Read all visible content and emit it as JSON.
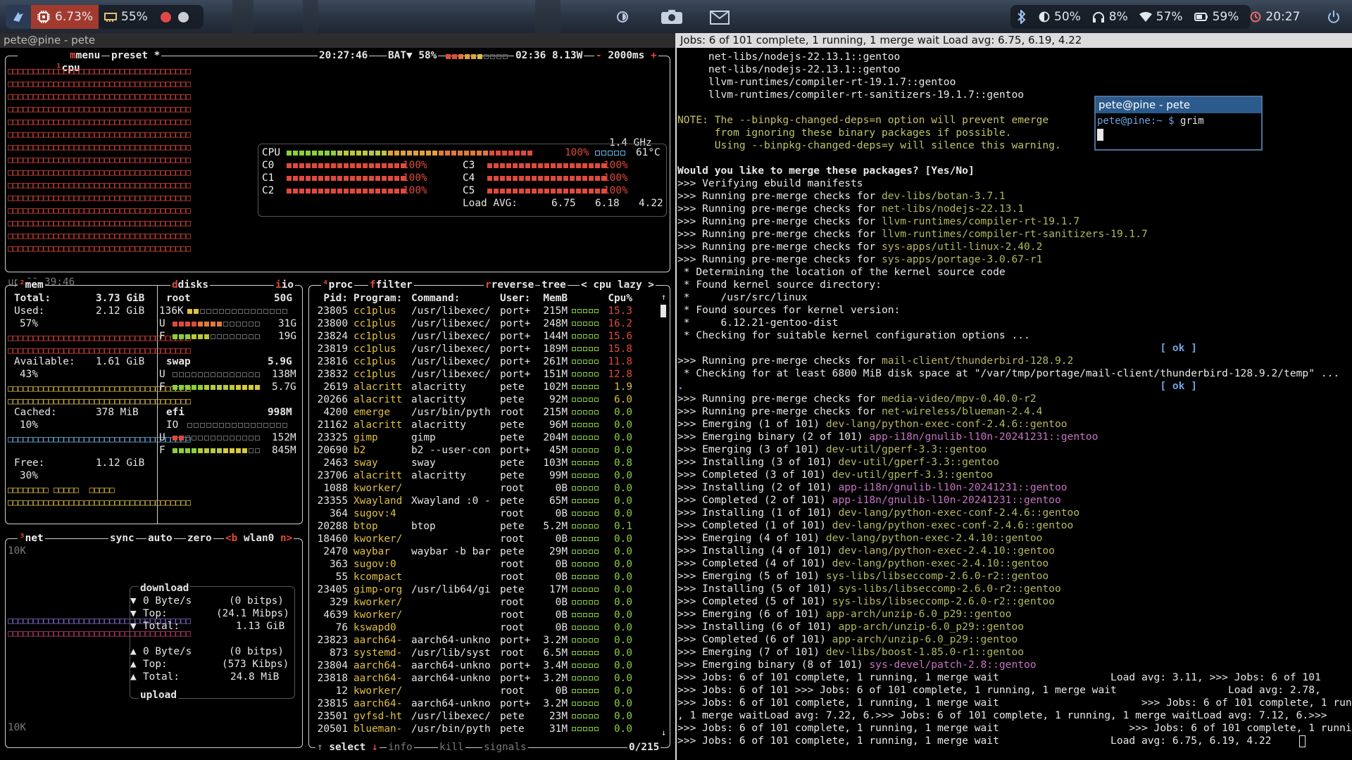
{
  "waybar": {
    "left": {
      "cpu_temp_icon": "chip-icon",
      "cpu_value": "6.73%",
      "mem_value": "55%"
    },
    "right": {
      "bluetooth_icon": "bluetooth-icon",
      "brightness": "50%",
      "volume": "8%",
      "wifi": "57%",
      "battery": "59%",
      "clock": "20:27"
    }
  },
  "btop_window": {
    "title": "pete@pine - pete"
  },
  "btop": {
    "cpu_header": {
      "tab": "cpu",
      "menu": "menu",
      "preset": "preset *",
      "clock": "20:27:46",
      "bat_label": "BAT▼ 58%",
      "bat_time": "02:36 8.13W",
      "interval": "2000ms",
      "minus": "-",
      "plus": "+"
    },
    "cpu_graph_up": "up 00:39:46",
    "cpu_info": {
      "freq": "1.4 GHz",
      "total_label": "CPU",
      "total_pct": "100%",
      "total_temp": "61°C",
      "cores": [
        {
          "name": "C0",
          "pct": "100%"
        },
        {
          "name": "C1",
          "pct": "100%"
        },
        {
          "name": "C2",
          "pct": "100%"
        },
        {
          "name": "C3",
          "pct": "100%"
        },
        {
          "name": "C4",
          "pct": "100%"
        },
        {
          "name": "C5",
          "pct": "100%"
        }
      ],
      "load_label": "Load AVG:",
      "load1": "6.75",
      "load5": "6.18",
      "load15": "4.22"
    },
    "mem": {
      "tab": "mem",
      "total_label": "Total:",
      "total": "3.73 GiB",
      "used_label": "Used:",
      "used": "2.12 GiB",
      "used_pct": "57%",
      "avail_label": "Available:",
      "avail": "1.61 GiB",
      "avail_pct": "43%",
      "cached_label": "Cached:",
      "cached": "378 MiB",
      "cached_pct": "10%",
      "free_label": "Free:",
      "free": "1.12 GiB",
      "free_pct": "30%"
    },
    "disks": {
      "tab": "disks",
      "io_tab": "io",
      "root_label": "root",
      "root_size": "50G",
      "root_io": "136K",
      "root_u": "31G",
      "root_f": "19G",
      "swap_label": "swap",
      "swap_size": "5.9G",
      "swap_u": "138M",
      "swap_f": "5.7G",
      "efi_label": "efi",
      "efi_size": "998M",
      "efi_io": "IO",
      "efi_u": "152M",
      "efi_f": "845M",
      "u": "U",
      "f": "F"
    },
    "net": {
      "tab": "net",
      "sync": "sync",
      "auto": "auto",
      "zero": "zero",
      "b": "<b",
      "iface": "wlan0",
      "n": "n>",
      "scale_top": "10K",
      "scale_bottom": "10K",
      "download_label": "download",
      "dl_rate": "0 Byte/s",
      "dl_bits": "(0 bitps)",
      "dl_top_label": "Top:",
      "dl_top": "(24.1 Mibps)",
      "dl_total_label": "Total:",
      "dl_total": "1.13 GiB",
      "ul_rate": "0 Byte/s",
      "ul_bits": "(0 bitps)",
      "ul_top_label": "Top:",
      "ul_top": "(573 Kibps)",
      "ul_total_label": "Total:",
      "ul_total": "24.8 MiB",
      "upload_label": "upload"
    },
    "proc": {
      "tab": "proc",
      "filter": "filter",
      "reverse": "reverse",
      "tree": "tree",
      "sort": "< cpu lazy >",
      "cols": {
        "pid": "Pid:",
        "program": "Program:",
        "command": "Command:",
        "user": "User:",
        "memb": "MemB",
        "cpu": "Cpu%"
      },
      "rows": [
        [
          "23805",
          "cc1plus",
          "/usr/libexec/",
          "port+",
          "215M",
          "15.3"
        ],
        [
          "23800",
          "cc1plus",
          "/usr/libexec/",
          "port+",
          "248M",
          "16.2"
        ],
        [
          "23824",
          "cc1plus",
          "/usr/libexec/",
          "port+",
          "144M",
          "15.6"
        ],
        [
          "23819",
          "cc1plus",
          "/usr/libexec/",
          "port+",
          "189M",
          "15.8"
        ],
        [
          "23816",
          "cc1plus",
          "/usr/libexec/",
          "port+",
          "261M",
          "11.8"
        ],
        [
          "23832",
          "cc1plus",
          "/usr/libexec/",
          "port+",
          "151M",
          "12.8"
        ],
        [
          "2619",
          "alacritt",
          "alacritty",
          "pete",
          "102M",
          "1.9"
        ],
        [
          "20266",
          "alacritt",
          "alacritty",
          "pete",
          "92M",
          "6.0"
        ],
        [
          "4200",
          "emerge",
          "/usr/bin/pyth",
          "root",
          "215M",
          "0.0"
        ],
        [
          "21162",
          "alacritt",
          "alacritty",
          "pete",
          "96M",
          "0.0"
        ],
        [
          "23325",
          "gimp",
          "gimp",
          "pete",
          "204M",
          "0.0"
        ],
        [
          "20690",
          "b2",
          "b2 --user-con",
          "port+",
          "45M",
          "0.0"
        ],
        [
          "2463",
          "sway",
          "sway",
          "pete",
          "103M",
          "0.8"
        ],
        [
          "23706",
          "alacritt",
          "alacritty",
          "pete",
          "99M",
          "0.0"
        ],
        [
          "1088",
          "kworker/",
          "",
          "root",
          "0B",
          "0.0"
        ],
        [
          "23355",
          "Xwayland",
          "Xwayland :0 -",
          "pete",
          "65M",
          "0.0"
        ],
        [
          "364",
          "sugov:4",
          "",
          "root",
          "0B",
          "0.0"
        ],
        [
          "20288",
          "btop",
          "btop",
          "pete",
          "5.2M",
          "0.1"
        ],
        [
          "18460",
          "kworker/",
          "",
          "root",
          "0B",
          "0.0"
        ],
        [
          "2470",
          "waybar",
          "waybar -b bar",
          "pete",
          "29M",
          "0.0"
        ],
        [
          "363",
          "sugov:0",
          "",
          "root",
          "0B",
          "0.0"
        ],
        [
          "55",
          "kcompact",
          "",
          "root",
          "0B",
          "0.0"
        ],
        [
          "23405",
          "gimp-org",
          "/usr/lib64/gi",
          "pete",
          "17M",
          "0.0"
        ],
        [
          "329",
          "kworker/",
          "",
          "root",
          "0B",
          "0.0"
        ],
        [
          "4639",
          "kworker/",
          "",
          "root",
          "0B",
          "0.0"
        ],
        [
          "76",
          "kswapd0",
          "",
          "root",
          "0B",
          "0.0"
        ],
        [
          "23823",
          "aarch64-",
          "aarch64-unkno",
          "port+",
          "3.2M",
          "0.0"
        ],
        [
          "873",
          "systemd-",
          "/usr/lib/syst",
          "root",
          "6.5M",
          "0.0"
        ],
        [
          "23804",
          "aarch64-",
          "aarch64-unkno",
          "port+",
          "3.4M",
          "0.0"
        ],
        [
          "23818",
          "aarch64-",
          "aarch64-unkno",
          "port+",
          "3.2M",
          "0.0"
        ],
        [
          "12",
          "kworker/",
          "",
          "root",
          "0B",
          "0.0"
        ],
        [
          "23815",
          "aarch64-",
          "aarch64-unkno",
          "port+",
          "3.2M",
          "0.0"
        ],
        [
          "23501",
          "gvfsd-ht",
          "/usr/libexec/",
          "pete",
          "23M",
          "0.0"
        ],
        [
          "20501",
          "blueman-",
          "/usr/bin/pyth",
          "pete",
          "31M",
          "0.0"
        ]
      ],
      "footer_select": "select",
      "footer_info": "info",
      "footer_kill": "kill",
      "footer_signals": "signals",
      "footer_count": "0/215"
    }
  },
  "terminal": {
    "title": "Jobs: 6 of 101 complete, 1 running, 1 merge wait Load avg: 6.75, 6.19, 4.22",
    "lines": [
      {
        "t": "     net-libs/nodejs-22.13.1::gentoo"
      },
      {
        "t": "     net-libs/nodejs-22.13.1::gentoo"
      },
      {
        "t": "     llvm-runtimes/compiler-rt-19.1.7::gentoo"
      },
      {
        "t": "     llvm-runtimes/compiler-rt-sanitizers-19.1.7::gentoo"
      },
      {
        "t": ""
      },
      {
        "t": "NOTE: The --binpkg-changed-deps=n option will prevent emerge",
        "c": "note"
      },
      {
        "t": "      from ignoring these binary packages if possible.",
        "c": "note"
      },
      {
        "t": "      Using --binpkg-changed-deps=y will silence this warning.",
        "c": "note"
      },
      {
        "t": ""
      },
      {
        "t": "Would you like to merge these packages? [Yes/No]",
        "c": "bld"
      },
      {
        "t": ">>> Verifying ebuild manifests"
      },
      {
        "t": ">>> Running pre-merge checks for ",
        "p": "dev-libs/botan-3.7.1"
      },
      {
        "t": ">>> Running pre-merge checks for ",
        "p": "net-libs/nodejs-22.13.1"
      },
      {
        "t": ">>> Running pre-merge checks for ",
        "p": "llvm-runtimes/compiler-rt-19.1.7"
      },
      {
        "t": ">>> Running pre-merge checks for ",
        "p": "llvm-runtimes/compiler-rt-sanitizers-19.1.7"
      },
      {
        "t": ">>> Running pre-merge checks for ",
        "p": "sys-apps/util-linux-2.40.2"
      },
      {
        "t": ">>> Running pre-merge checks for ",
        "p": "sys-apps/portage-3.0.67-r1"
      },
      {
        "t": " * Determining the location of the kernel source code"
      },
      {
        "t": " * Found kernel source directory:"
      },
      {
        "t": " *     /usr/src/linux"
      },
      {
        "t": " * Found sources for kernel version:"
      },
      {
        "t": " *     6.12.21-gentoo-dist"
      },
      {
        "t": " * Checking for suitable kernel configuration options ..."
      },
      {
        "t": "                                                                              [ ok ]",
        "c": "tok"
      },
      {
        "t": ">>> Running pre-merge checks for ",
        "p": "mail-client/thunderbird-128.9.2"
      },
      {
        "t": " * Checking for at least 6800 MiB disk space at \"/var/tmp/portage/mail-client/thunderbird-128.9.2/temp\" ..."
      },
      {
        "t": ".                                                                             [ ok ]",
        "c": "tok"
      },
      {
        "t": ">>> Running pre-merge checks for ",
        "p": "media-video/mpv-0.40.0-r2"
      },
      {
        "t": ">>> Running pre-merge checks for ",
        "p": "net-wireless/blueman-2.4.4"
      },
      {
        "t": ">>> Emerging (1 of 101) ",
        "p": "dev-lang/python-exec-conf-2.4.6::gentoo"
      },
      {
        "t": ">>> Emerging binary (2 of 101) ",
        "p": "app-i18n/gnulib-l10n-20241231::gentoo",
        "bin": true
      },
      {
        "t": ">>> Emerging (3 of 101) ",
        "p": "dev-util/gperf-3.3::gentoo"
      },
      {
        "t": ">>> Installing (3 of 101) ",
        "p": "dev-util/gperf-3.3::gentoo"
      },
      {
        "t": ">>> Completed (3 of 101) ",
        "p": "dev-util/gperf-3.3::gentoo"
      },
      {
        "t": ">>> Installing (2 of 101) ",
        "p": "app-i18n/gnulib-l10n-20241231::gentoo",
        "bin": true
      },
      {
        "t": ">>> Completed (2 of 101) ",
        "p": "app-i18n/gnulib-l10n-20241231::gentoo",
        "bin": true
      },
      {
        "t": ">>> Installing (1 of 101) ",
        "p": "dev-lang/python-exec-conf-2.4.6::gentoo"
      },
      {
        "t": ">>> Completed (1 of 101) ",
        "p": "dev-lang/python-exec-conf-2.4.6::gentoo"
      },
      {
        "t": ">>> Emerging (4 of 101) ",
        "p": "dev-lang/python-exec-2.4.10::gentoo"
      },
      {
        "t": ">>> Installing (4 of 101) ",
        "p": "dev-lang/python-exec-2.4.10::gentoo"
      },
      {
        "t": ">>> Completed (4 of 101) ",
        "p": "dev-lang/python-exec-2.4.10::gentoo"
      },
      {
        "t": ">>> Emerging (5 of 101) ",
        "p": "sys-libs/libseccomp-2.6.0-r2::gentoo"
      },
      {
        "t": ">>> Installing (5 of 101) ",
        "p": "sys-libs/libseccomp-2.6.0-r2::gentoo"
      },
      {
        "t": ">>> Completed (5 of 101) ",
        "p": "sys-libs/libseccomp-2.6.0-r2::gentoo"
      },
      {
        "t": ">>> Emerging (6 of 101) ",
        "p": "app-arch/unzip-6.0_p29::gentoo"
      },
      {
        "t": ">>> Installing (6 of 101) ",
        "p": "app-arch/unzip-6.0_p29::gentoo"
      },
      {
        "t": ">>> Completed (6 of 101) ",
        "p": "app-arch/unzip-6.0_p29::gentoo"
      },
      {
        "t": ">>> Emerging (7 of 101) ",
        "p": "dev-libs/boost-1.85.0-r1::gentoo"
      },
      {
        "t": ">>> Emerging binary (8 of 101) ",
        "p": "sys-devel/patch-2.8::gentoo",
        "bin": true
      },
      {
        "t": ">>> Jobs: 6 of 101 complete, 1 running, 1 merge wait                  Load avg: 3.11, >>> Jobs: 6 of 101"
      },
      {
        "t": ">>> Jobs: 6 of 101 >>> Jobs: 6 of 101 complete, 1 running, 1 merge wait                  Load avg: 2.78,"
      },
      {
        "t": ">>> Jobs: 6 of 101 complete, 1 running, 1 merge wait                       >>> Jobs: 6 of 101 complete, 1 running"
      },
      {
        "t": ", 1 merge waitLoad avg: 7.22, 6.>>> Jobs: 6 of 101 complete, 1 running, 1 merge waitLoad avg: 7.12, 6.>>>"
      },
      {
        "t": ">>> Jobs: 6 of 101 complete, 1 running, 1 merge wait                     >>> Jobs: 6 of 101 complete, 1 running,"
      },
      {
        "t": ">>> Jobs: 6 of 101 complete, 1 running, 1 merge wait                  Load avg: 6.75, 6.19, 4.22"
      }
    ]
  },
  "floating_terminal": {
    "title": "pete@pine - pete",
    "prompt": "pete@pine:~ $ ",
    "command": "grim"
  }
}
